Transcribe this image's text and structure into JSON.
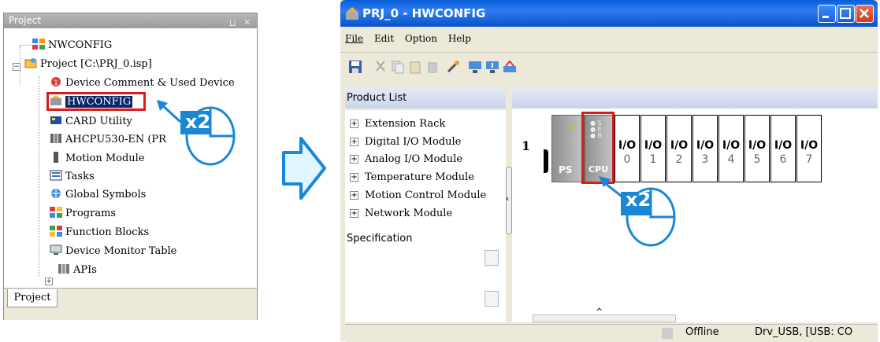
{
  "project_panel": {
    "title": "Project",
    "tab": "Project",
    "items": [
      {
        "label": "NWCONFIG",
        "icon": "network-config-icon"
      },
      {
        "label": "Project [C:\\PRJ_0.isp]",
        "icon": "project-icon"
      },
      {
        "label": "Device Comment & Used Device",
        "icon": "device-comment-icon"
      },
      {
        "label": "HWCONFIG",
        "icon": "hardware-config-icon"
      },
      {
        "label": "CARD Utility",
        "icon": "card-utility-icon"
      },
      {
        "label": "AHCPU530-EN  (PR",
        "icon": "cpu-device-icon"
      },
      {
        "label": "Motion Module",
        "icon": "motion-module-icon"
      },
      {
        "label": "Tasks",
        "icon": "tasks-icon"
      },
      {
        "label": "Global Symbols",
        "icon": "global-symbols-icon"
      },
      {
        "label": "Programs",
        "icon": "programs-icon"
      },
      {
        "label": "Function Blocks",
        "icon": "function-blocks-icon"
      },
      {
        "label": "Device Monitor Table",
        "icon": "device-monitor-icon"
      },
      {
        "label": "APIs",
        "icon": "apis-icon"
      }
    ]
  },
  "annotations": {
    "double_click_badge": "x2"
  },
  "window": {
    "title": "PRJ_0 - HWCONFIG",
    "menu": [
      "File",
      "Edit",
      "Option",
      "Help"
    ],
    "product_list_header": "Product List",
    "product_list": [
      "Extension Rack",
      "Digital I/O Module",
      "Analog I/O Module",
      "Temperature Module",
      "Motion Control Module",
      "Network Module"
    ],
    "specification_header": "Specification",
    "rack": {
      "rack_number": "1",
      "ps_label": "PS",
      "cpu_label": "CPU",
      "cpu_leds": [
        "S",
        "E",
        "B"
      ],
      "io_slots": [
        {
          "label": "I/O",
          "num": "0"
        },
        {
          "label": "I/O",
          "num": "1"
        },
        {
          "label": "I/O",
          "num": "2"
        },
        {
          "label": "I/O",
          "num": "3"
        },
        {
          "label": "I/O",
          "num": "4"
        },
        {
          "label": "I/O",
          "num": "5"
        },
        {
          "label": "I/O",
          "num": "6"
        },
        {
          "label": "I/O",
          "num": "7"
        }
      ]
    },
    "status": {
      "mode": "Offline",
      "connection": "Drv_USB, [USB: CO"
    }
  },
  "colors": {
    "highlight_red": "#d81b1b",
    "callout_blue": "#1a86d6",
    "titlebar_blue": "#0a5fd8",
    "selection_blue": "#0a246a"
  }
}
